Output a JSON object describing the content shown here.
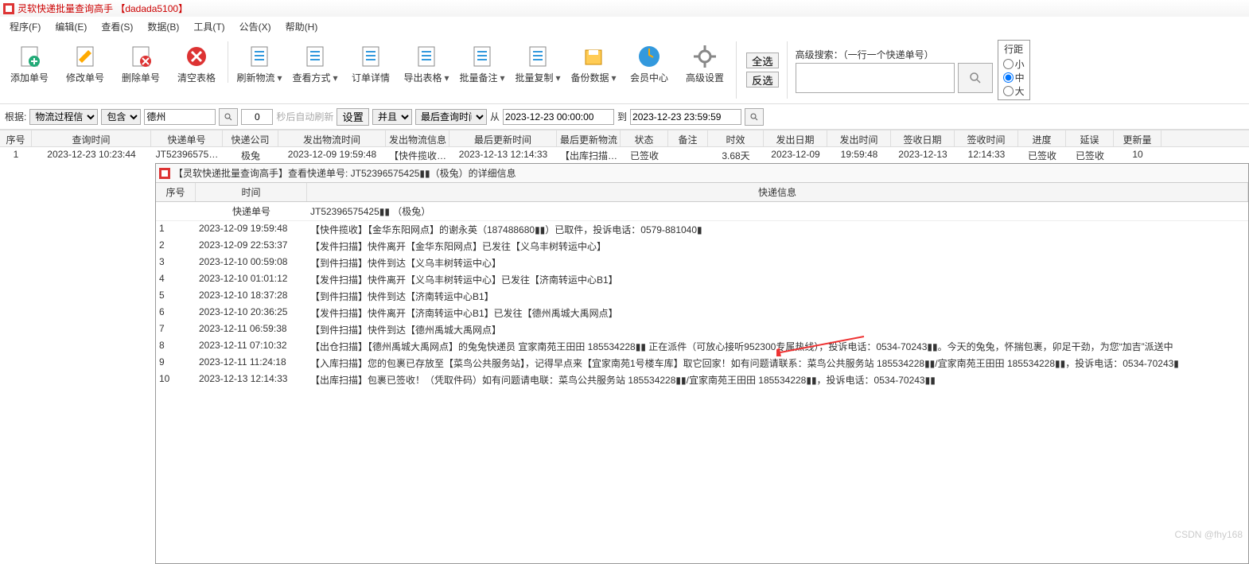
{
  "title": "灵软快递批量查询高手 【dadada5100】",
  "menus": [
    "程序(F)",
    "编辑(E)",
    "查看(S)",
    "数据(B)",
    "工具(T)",
    "公告(X)",
    "帮助(H)"
  ],
  "toolbar": [
    {
      "id": "add",
      "label": "添加单号"
    },
    {
      "id": "edit",
      "label": "修改单号"
    },
    {
      "id": "del",
      "label": "删除单号"
    },
    {
      "id": "clear",
      "label": "清空表格"
    },
    {
      "id": "refresh",
      "label": "刷新物流",
      "dd": true
    },
    {
      "id": "viewmode",
      "label": "查看方式",
      "dd": true
    },
    {
      "id": "detail",
      "label": "订单详情"
    },
    {
      "id": "export",
      "label": "导出表格",
      "dd": true
    },
    {
      "id": "batchnote",
      "label": "批量备注",
      "dd": true
    },
    {
      "id": "batchcopy",
      "label": "批量复制",
      "dd": true
    },
    {
      "id": "backup",
      "label": "备份数据",
      "dd": true
    },
    {
      "id": "vip",
      "label": "会员中心"
    },
    {
      "id": "adv",
      "label": "高级设置"
    }
  ],
  "right_actions": {
    "select_all": "全选",
    "invert": "反选"
  },
  "adv_search_label": "高级搜索：（一行一个快递单号）",
  "spacing": {
    "title": "行距",
    "small": "小",
    "mid": "中",
    "large": "大"
  },
  "filter": {
    "root_label": "根据:",
    "field": "物流过程信息",
    "op": "包含",
    "value": "德州",
    "count": "0",
    "auto_label": "秒后自动刷新",
    "set_btn": "设置",
    "logic": "并且",
    "field2": "最后查询时间",
    "from_label": "从",
    "from": "2023-12-23 00:00:00",
    "to_label": "到",
    "to": "2023-12-23 23:59:59"
  },
  "grid_headers": [
    "序号",
    "查询时间",
    "快递单号",
    "快递公司",
    "发出物流时间",
    "发出物流信息",
    "最后更新时间",
    "最后更新物流",
    "状态",
    "备注",
    "时效",
    "发出日期",
    "发出时间",
    "签收日期",
    "签收时间",
    "进度",
    "延误",
    "更新量"
  ],
  "grid_rows": [
    {
      "seq": "1",
      "qt": "2023-12-23 10:23:44",
      "tn": "JT52396575…",
      "co": "极兔",
      "dt": "2023-12-09 19:59:48",
      "di": "【快件揽收…",
      "lt": "2023-12-13 12:14:33",
      "ll": "【出库扫描…",
      "st": "已签收",
      "rm": "",
      "du": "3.68天",
      "sd": "2023-12-09",
      "stm": "19:59:48",
      "rd": "2023-12-13",
      "rtm": "12:14:33",
      "pg": "已签收",
      "dl": "已签收",
      "uc": "10"
    }
  ],
  "detail": {
    "title": "【灵软快递批量查询高手】查看快递单号: JT52396575425▮▮（极兔）的详细信息",
    "headers": {
      "seq": "序号",
      "time": "时间",
      "info": "快递信息"
    },
    "sub": {
      "tn_label": "快递单号",
      "tn": "JT52396575425▮▮ （极兔）"
    },
    "rows": [
      {
        "n": "1",
        "t": "2023-12-09 19:59:48",
        "i": "【快件揽收】【金华东阳网点】的谢永英（187488680▮▮）已取件，投诉电话：0579-881040▮"
      },
      {
        "n": "2",
        "t": "2023-12-09 22:53:37",
        "i": "【发件扫描】快件离开【金华东阳网点】已发往【义乌丰树转运中心】"
      },
      {
        "n": "3",
        "t": "2023-12-10 00:59:08",
        "i": "【到件扫描】快件到达【义乌丰树转运中心】"
      },
      {
        "n": "4",
        "t": "2023-12-10 01:01:12",
        "i": "【发件扫描】快件离开【义乌丰树转运中心】已发往【济南转运中心B1】"
      },
      {
        "n": "5",
        "t": "2023-12-10 18:37:28",
        "i": "【到件扫描】快件到达【济南转运中心B1】"
      },
      {
        "n": "6",
        "t": "2023-12-10 20:36:25",
        "i": "【发件扫描】快件离开【济南转运中心B1】已发往【德州禹城大禹网点】"
      },
      {
        "n": "7",
        "t": "2023-12-11 06:59:38",
        "i": "【到件扫描】快件到达【德州禹城大禹网点】"
      },
      {
        "n": "8",
        "t": "2023-12-11 07:10:32",
        "i": "【出仓扫描】【德州禹城大禹网点】的兔兔快递员 宜家南苑王田田 185534228▮▮ 正在派件（可放心接听952300专属热线），投诉电话：0534-70243▮▮。今天的兔兔，怀揣包裹，卯足干劲，为您“加吉”派送中"
      },
      {
        "n": "9",
        "t": "2023-12-11 11:24:18",
        "i": "【入库扫描】您的包裹已存放至【菜鸟公共服务站】，记得早点来【宜家南苑1号楼车库】取它回家！如有问题请联系：菜鸟公共服务站 185534228▮▮/宜家南苑王田田 185534228▮▮，投诉电话：0534-70243▮"
      },
      {
        "n": "10",
        "t": "2023-12-13 12:14:33",
        "i": "【出库扫描】包裹已签收！（凭取件码）如有问题请电联：菜鸟公共服务站 185534228▮▮/宜家南苑王田田 185534228▮▮，投诉电话：0534-70243▮▮"
      }
    ]
  },
  "watermark": "CSDN @fhy168"
}
